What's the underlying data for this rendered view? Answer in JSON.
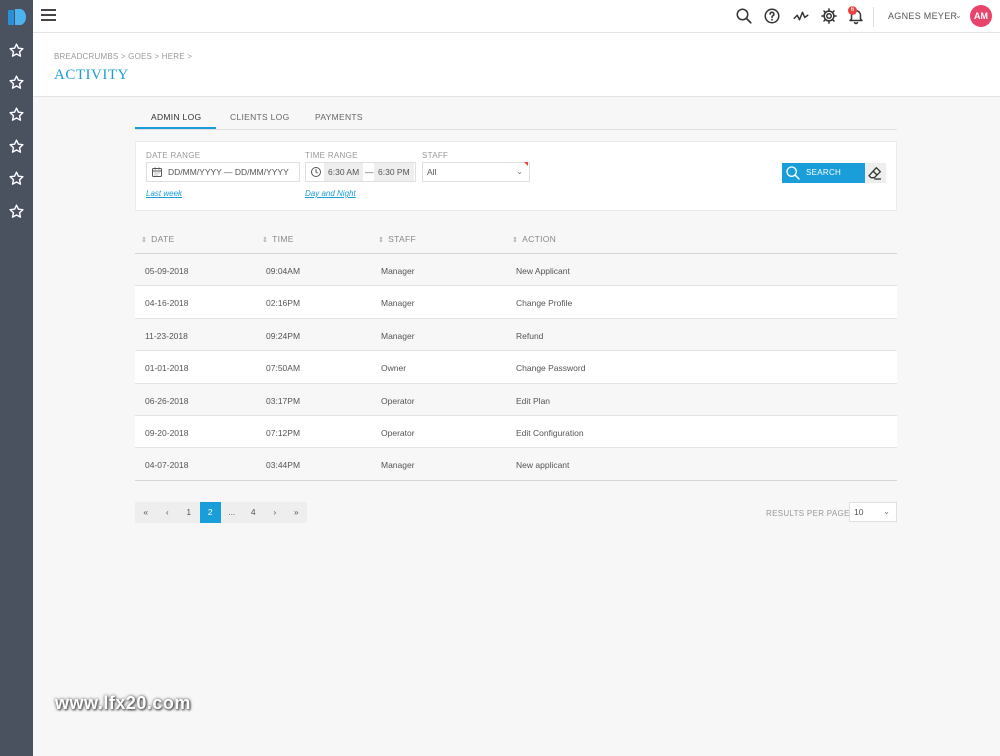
{
  "topbar": {
    "user_name": "AGNES MEYER",
    "avatar_initials": "AM",
    "notification_count": "6"
  },
  "header": {
    "breadcrumb": "BREADCRUMBS > GOES > HERE >",
    "title": "ACTIVITY"
  },
  "tabs": [
    {
      "label": "ADMIN LOG",
      "active": true
    },
    {
      "label": "CLIENTS LOG",
      "active": false
    },
    {
      "label": "PAYMENTS",
      "active": false
    }
  ],
  "filter": {
    "date_range_label": "DATE RANGE",
    "date_range_value": "DD/MM/YYYY — DD/MM/YYYY",
    "date_link": "Last week",
    "time_range_label": "TIME RANGE",
    "time_from": "6:30 AM",
    "time_sep": "—",
    "time_to": "6:30 PM",
    "time_link": "Day and Night",
    "staff_label": "STAFF",
    "staff_value": "All",
    "search_label": "SEARCH"
  },
  "table": {
    "headers": [
      "DATE",
      "TIME",
      "STAFF",
      "ACTION"
    ],
    "rows": [
      [
        "05-09-2018",
        "09:04AM",
        "Manager",
        "New Applicant"
      ],
      [
        "04-16-2018",
        "02:16PM",
        "Manager",
        "Change Profile"
      ],
      [
        "11-23-2018",
        "09:24PM",
        "Manager",
        "Refund"
      ],
      [
        "01-01-2018",
        "07:50AM",
        "Owner",
        "Change Password"
      ],
      [
        "06-26-2018",
        "03:17PM",
        "Operator",
        "Edit Plan"
      ],
      [
        "09-20-2018",
        "07:12PM",
        "Operator",
        "Edit Configuration"
      ],
      [
        "04-07-2018",
        "03:44PM",
        "Manager",
        "New applicant"
      ]
    ]
  },
  "pagination": {
    "items": [
      "«",
      "‹",
      "1",
      "2",
      "...",
      "4",
      "›",
      "»"
    ],
    "active_index": 3,
    "results_per_page_label": "RESULTS PER PAGE",
    "results_per_page_value": "10"
  },
  "watermark": "www.lfx20.com",
  "colors": {
    "accent": "#1a9ed9",
    "sidebar": "#4a5260",
    "avatar": "#e8436a",
    "badge": "#e8433f"
  }
}
